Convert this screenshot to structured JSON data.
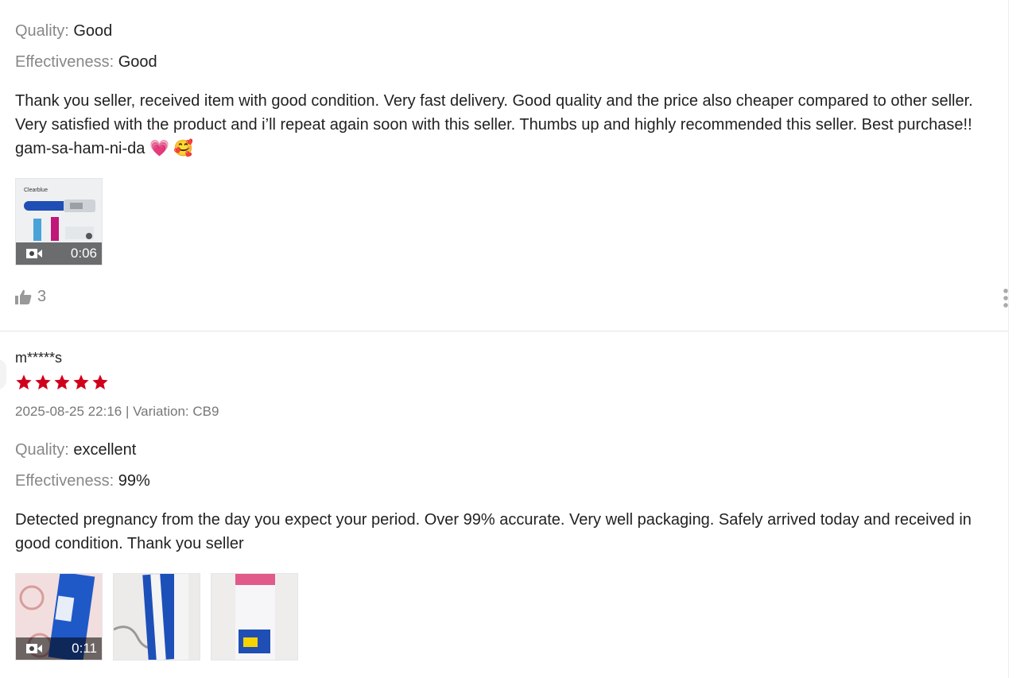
{
  "review1": {
    "quality_label": "Quality:",
    "quality_value": "Good",
    "effectiveness_label": "Effectiveness:",
    "effectiveness_value": "Good",
    "text": "Thank you seller, received item with good condition.  Very fast delivery. Good quality and the price also cheaper compared to other seller. Very satisfied with the product and i’ll repeat again soon with this seller. Thumbs up and highly recommended this seller. Best purchase!! gam-sa-ham-ni-da",
    "emoji": "💗 🥰",
    "video_duration": "0:06",
    "thumb_brand": "Clearblue",
    "likes": "3"
  },
  "review2": {
    "username": "m*****s",
    "rating": 5,
    "meta": "2025-08-25 22:16 | Variation: CB9",
    "quality_label": "Quality:",
    "quality_value": "excellent",
    "effectiveness_label": "Effectiveness:",
    "effectiveness_value": "99%",
    "text": "Detected pregnancy from the day you expect your period. Over 99% accurate. Very well packaging. Safely arrived today and received in good condition. Thank you seller",
    "video_duration": "0:11"
  },
  "colors": {
    "star": "#d0011b",
    "muted": "#888888",
    "text": "#222222"
  }
}
